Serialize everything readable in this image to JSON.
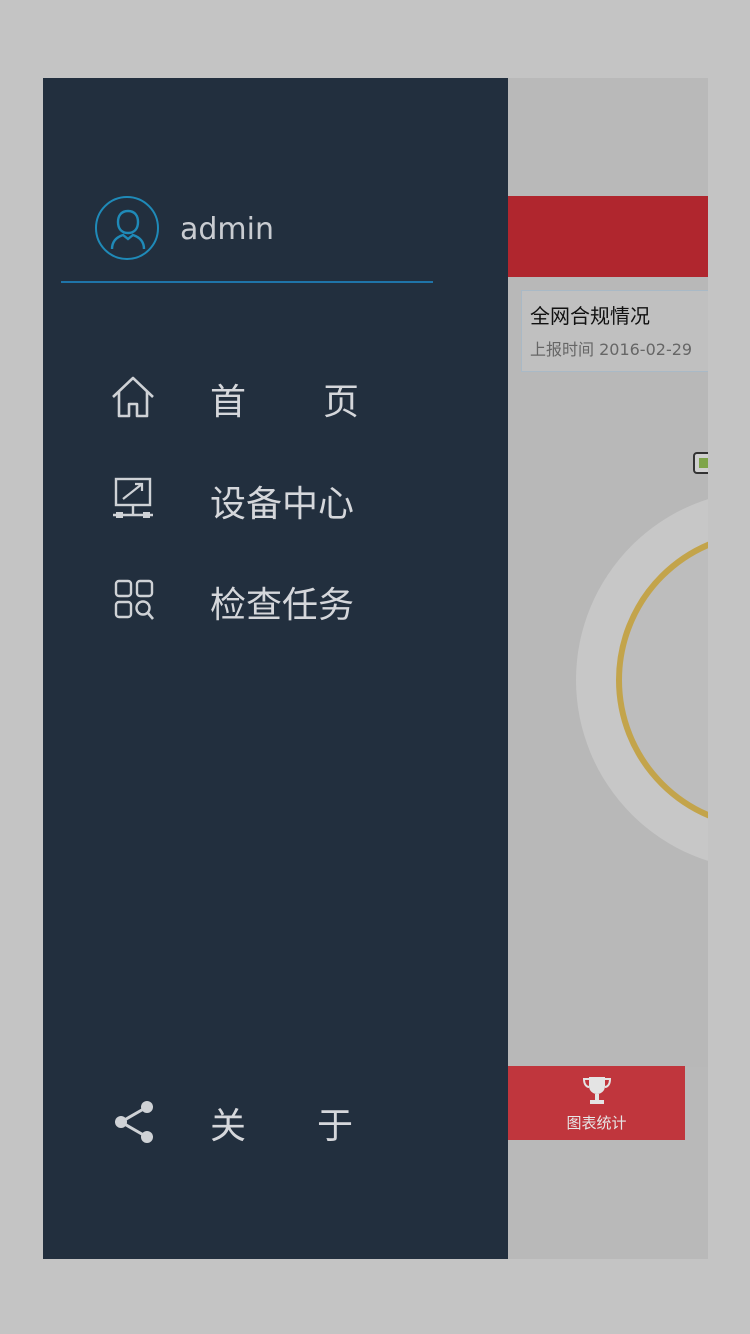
{
  "drawer": {
    "username": "admin",
    "menu": [
      {
        "id": "home",
        "label_a": "首",
        "label_b": "页",
        "icon": "home-icon"
      },
      {
        "id": "device-center",
        "label": "设备中心",
        "icon": "monitor-network-icon"
      },
      {
        "id": "inspection-tasks",
        "label": "检查任务",
        "icon": "grid-search-icon"
      }
    ],
    "about": {
      "label_a": "关",
      "label_b": "于",
      "icon": "share-icon"
    }
  },
  "background": {
    "report": {
      "title": "全网合规情况",
      "time": "上报时间 2016-02-29"
    },
    "bottom_tab": {
      "label": "图表统计",
      "icon": "trophy-icon"
    }
  },
  "colors": {
    "drawer_bg": "#222f3e",
    "accent_blue": "#1f8ab8",
    "brand_red": "#b0262e",
    "gauge_gold": "#c3a44b"
  }
}
